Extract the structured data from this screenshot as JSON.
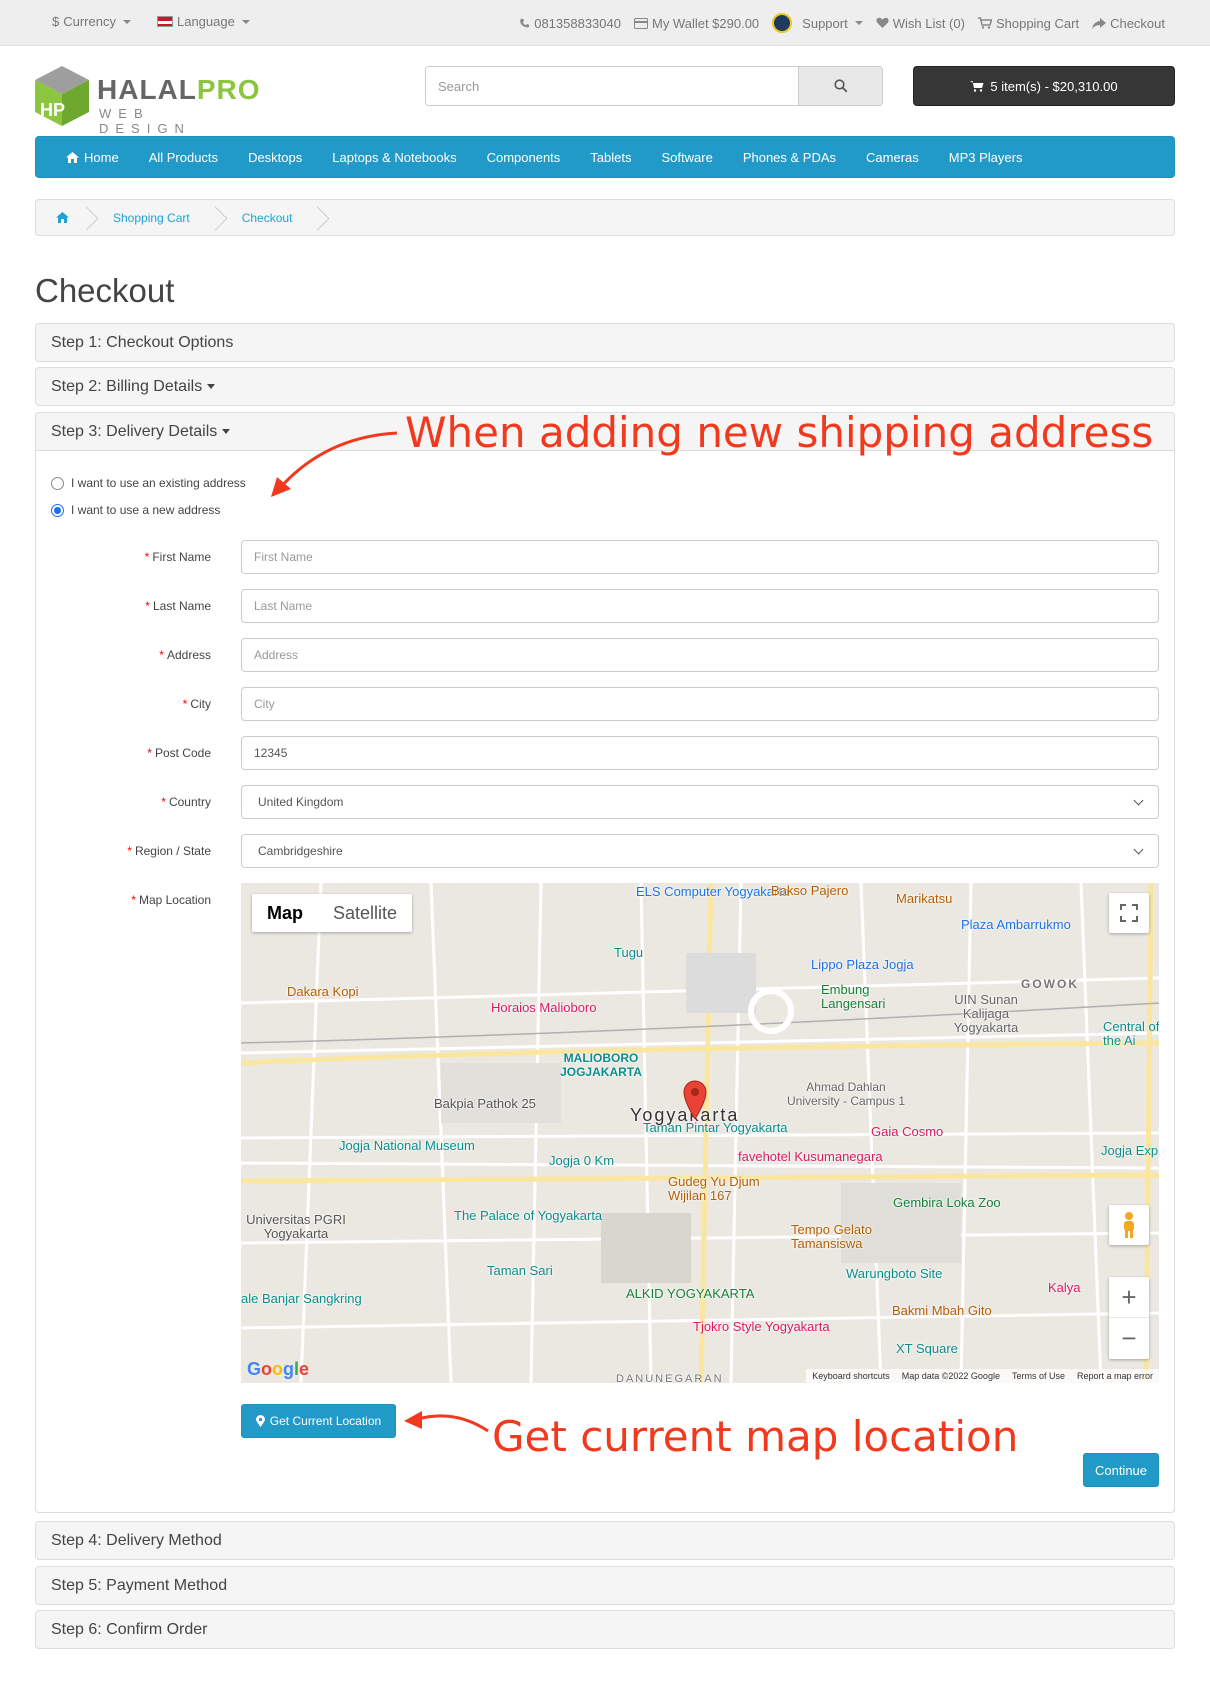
{
  "topbar": {
    "currency": "Currency",
    "language": "Language",
    "phone": "081358833040",
    "wallet": "My Wallet $290.00",
    "support": "Support",
    "wishlist": "Wish List (0)",
    "cart": "Shopping Cart",
    "checkout": "Checkout"
  },
  "header": {
    "logo_main": "HALAL",
    "logo_accent": "PRO",
    "logo_sub": "WEB DESIGN",
    "search_placeholder": "Search",
    "cart_button": "5 item(s) - $20,310.00"
  },
  "nav": {
    "items": [
      "Home",
      "All Products",
      "Desktops",
      "Laptops & Notebooks",
      "Components",
      "Tablets",
      "Software",
      "Phones & PDAs",
      "Cameras",
      "MP3 Players"
    ]
  },
  "breadcrumb": [
    "Shopping Cart",
    "Checkout"
  ],
  "page_title": "Checkout",
  "steps": {
    "s1": "Step 1: Checkout Options",
    "s2": "Step 2: Billing Details",
    "s3": "Step 3: Delivery Details",
    "s4": "Step 4: Delivery Method",
    "s5": "Step 5: Payment Method",
    "s6": "Step 6: Confirm Order"
  },
  "address_options": {
    "existing": "I want to use an existing address",
    "new": "I want to use a new address",
    "selected": "new"
  },
  "form": {
    "first_name": {
      "label": "First Name",
      "placeholder": "First Name"
    },
    "last_name": {
      "label": "Last Name",
      "placeholder": "Last Name"
    },
    "address": {
      "label": "Address",
      "placeholder": "Address"
    },
    "city": {
      "label": "City",
      "placeholder": "City"
    },
    "post_code": {
      "label": "Post Code",
      "value": "12345"
    },
    "country": {
      "label": "Country",
      "value": "United Kingdom"
    },
    "region": {
      "label": "Region / State",
      "value": "Cambridgeshire"
    },
    "map_location": {
      "label": "Map Location"
    }
  },
  "map": {
    "tab_map": "Map",
    "tab_satellite": "Satellite",
    "city_label": "Yogyakarta",
    "places": [
      "ELS Computer Yogyakarta",
      "Bakso Pajero",
      "Marikatsu",
      "Plaza Ambarrukmo",
      "Tugu",
      "Lippo Plaza Jogja",
      "Dakara Kopi",
      "Horaios Malioboro",
      "Embung Langensari",
      "UIN Sunan Kalijaga Yogyakarta",
      "MALIOBORO JOGJAKARTA",
      "Bakpia Pathok 25",
      "Taman Pintar Yogyakarta",
      "Ahmad Dahlan University - Campus 1",
      "Gaia Cosmo",
      "Jogja National Museum",
      "Jogja 0 Km",
      "favehotel Kusumanegara",
      "Gudeg Yu Djum Wijilan 167",
      "Gembira Loka Zoo",
      "Universitas PGRI Yogyakarta",
      "The Palace of Yogyakarta",
      "Tempo Gelato Tamansiswa",
      "Taman Sari",
      "Warungboto Site",
      "ALKID YOGYAKARTA",
      "Kalya",
      "Bakmi Mbah Gito",
      "Tjokro Style Yogyakarta",
      "XT Square",
      "GOWOK",
      "Central of the Ai",
      "Jogja Exp",
      "ale Banjar Sangkring",
      "DANUNEGARAN"
    ],
    "footer": [
      "Keyboard shortcuts",
      "Map data ©2022 Google",
      "Terms of Use",
      "Report a map error"
    ],
    "google": "Google"
  },
  "buttons": {
    "current_location": "Get Current Location",
    "continue": "Continue"
  },
  "annotations": {
    "top": "When adding new shipping address",
    "bottom": "Get current map location"
  },
  "colors": {
    "accent": "#229ac8",
    "annotation": "#f2391d",
    "logo_green": "#8cc63f"
  }
}
